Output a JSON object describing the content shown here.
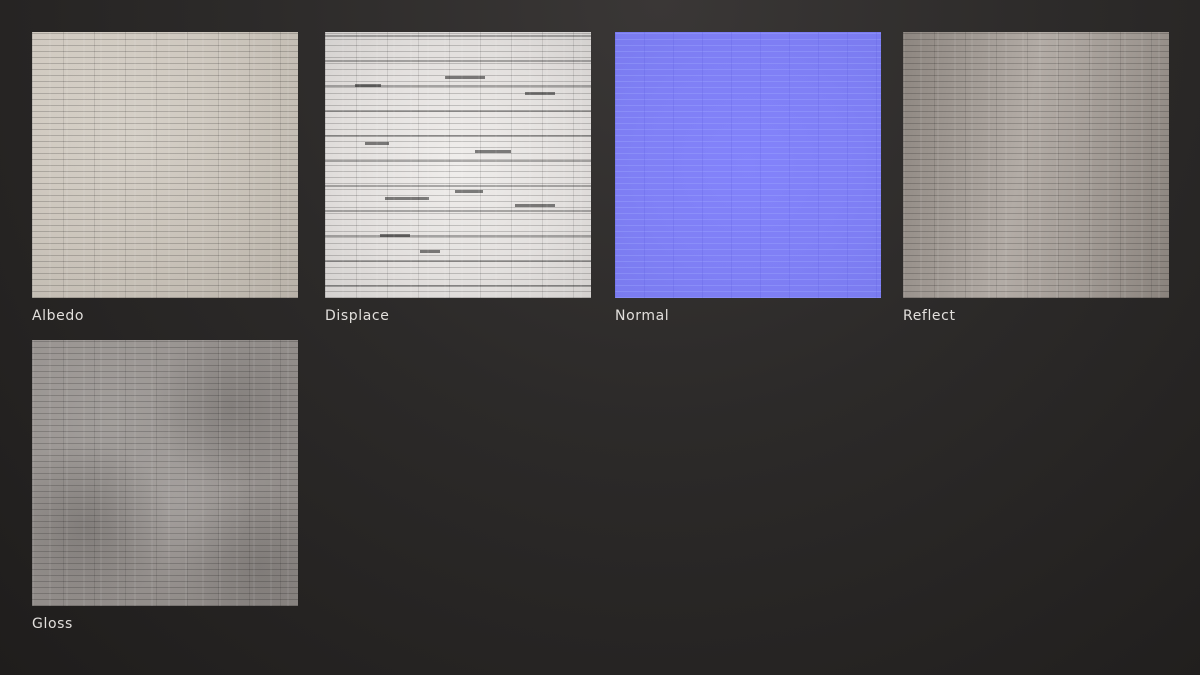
{
  "maps": [
    {
      "id": "albedo",
      "label": "Albedo"
    },
    {
      "id": "displace",
      "label": "Displace"
    },
    {
      "id": "normal",
      "label": "Normal"
    },
    {
      "id": "reflect",
      "label": "Reflect"
    },
    {
      "id": "gloss",
      "label": "Gloss"
    }
  ],
  "colors": {
    "background": "#2c2a29",
    "label_text": "#e2dfdc",
    "albedo": "#d4cdc3",
    "displace": "#e6e3e1",
    "normal": "#8080f8",
    "reflect": "#a39c96",
    "gloss": "#98938f"
  }
}
